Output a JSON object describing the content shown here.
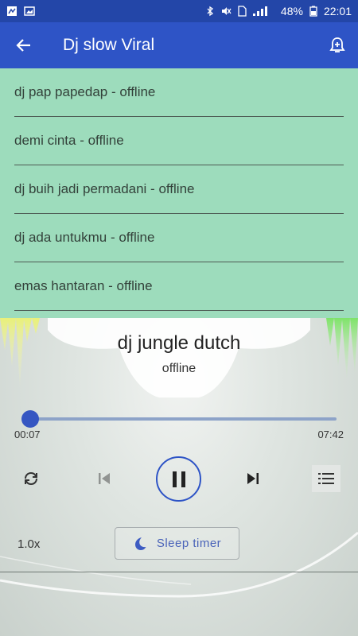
{
  "status_bar": {
    "battery": "48%",
    "time": "22:01",
    "icons": [
      "notification-icon",
      "image-icon",
      "bluetooth-icon",
      "mute-icon",
      "sim-icon",
      "signal-icon",
      "battery-icon"
    ]
  },
  "app_bar": {
    "title": "Dj slow Viral",
    "back_icon": "arrow-left-icon",
    "action_icon": "alarm-add-icon"
  },
  "playlist": {
    "items": [
      {
        "label": "dj pap papedap - offline"
      },
      {
        "label": "demi cinta - offline"
      },
      {
        "label": "dj buih jadi permadani - offline"
      },
      {
        "label": "dj ada untukmu - offline"
      },
      {
        "label": "emas hantaran - offline"
      }
    ]
  },
  "now_playing": {
    "title": "dj jungle dutch",
    "subtitle": "offline",
    "current_time": "00:07",
    "total_time": "07:42",
    "progress": 0.016
  },
  "controls": {
    "repeat_icon": "repeat-icon",
    "previous_icon": "skip-previous-icon",
    "play_pause_icon": "pause-icon",
    "next_icon": "skip-next-icon",
    "playlist_icon": "list-icon"
  },
  "bottom": {
    "speed": "1.0x",
    "sleep_timer": "Sleep timer",
    "sleep_icon": "moon-icon"
  },
  "colors": {
    "primary": "#2e54c6",
    "status_bar": "#2346a8",
    "playlist_bg": "#9ddcbc"
  }
}
